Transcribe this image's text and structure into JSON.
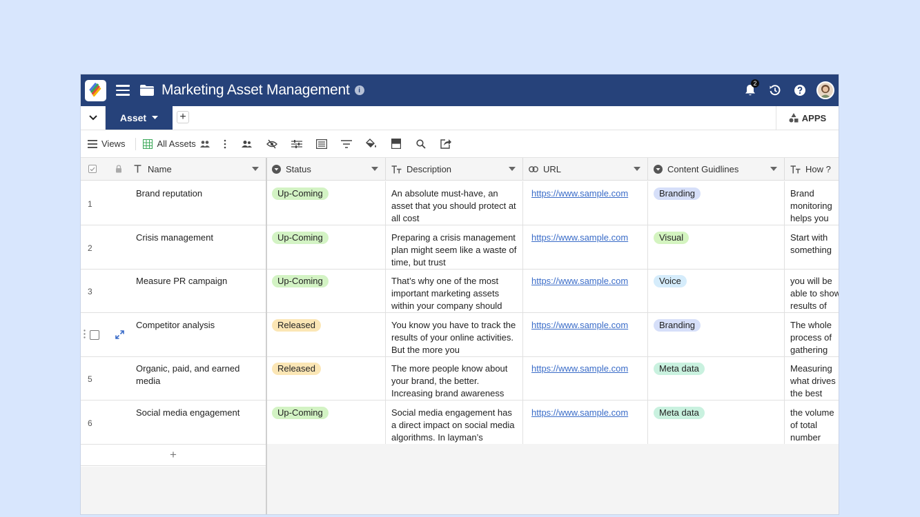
{
  "header": {
    "title": "Marketing Asset Management",
    "info_glyph": "i",
    "notification_count": "2",
    "bg_color": "#26427a"
  },
  "tabs": {
    "active_label": "Asset",
    "add_glyph": "+",
    "apps_label": "APPS"
  },
  "toolbar": {
    "views_label": "Views",
    "view_name": "All Assets"
  },
  "columns": [
    {
      "label": "Name",
      "icon": "text-icon"
    },
    {
      "label": "Status",
      "icon": "single-select-icon"
    },
    {
      "label": "Description",
      "icon": "long-text-icon"
    },
    {
      "label": "URL",
      "icon": "link-icon"
    },
    {
      "label": "Content Guidlines",
      "icon": "single-select-icon"
    },
    {
      "label": "How ?",
      "icon": "long-text-icon"
    }
  ],
  "rows": [
    {
      "num": "1",
      "name": "Brand reputation",
      "status": "Up-Coming",
      "description": "An absolute must-have, an asset that you should protect at all cost",
      "url": "https://www.sample.com",
      "guideline": "Branding",
      "how": "Brand monitoring helps you collect all public online pieces"
    },
    {
      "num": "2",
      "name": "Crisis management",
      "status": "Up-Coming",
      "description": "Preparing a crisis management plan might seem like a waste of time, but trust",
      "url": "https://www.sample.com",
      "guideline": "Visual",
      "how": "Start with something\n\nUpdate your"
    },
    {
      "num": "3",
      "name": "Measure PR campaign",
      "status": "Up-Coming",
      "description": "That’s why one of the most important marketing assets within your company should",
      "url": "https://www.sample.com",
      "guideline": "Voice",
      "how": "you will be able to show results of your supervisors"
    },
    {
      "num": "4",
      "name": "Competitor analysis",
      "status": "Released",
      "description": "You know you have to track the results of your online activities. But the more you",
      "url": "https://www.sample.com",
      "guideline": "Branding",
      "how": "The whole process of gathering and analyzing"
    },
    {
      "num": "5",
      "name": "Organic, paid, and earned media",
      "status": "Released",
      "description": "The more people know about your brand, the better. Increasing brand awareness",
      "url": "https://www.sample.com",
      "guideline": "Meta data",
      "how": "Measuring what drives the best your website"
    },
    {
      "num": "6",
      "name": "Social media engagement",
      "status": "Up-Coming",
      "description": "Social media engagement has a direct impact on social media algorithms. In layman’s",
      "url": "https://www.sample.com",
      "guideline": "Meta data",
      "how": "the volume of total number"
    }
  ],
  "add_row_glyph": "+",
  "colors": {
    "status": {
      "Up-Coming": "#d3f3c4",
      "Released": "#fbe6b5"
    },
    "guideline": {
      "Branding": "#d6dff9",
      "Visual": "#d4f4c0",
      "Voice": "#d5ecfb",
      "Meta data": "#c9f1df"
    }
  }
}
